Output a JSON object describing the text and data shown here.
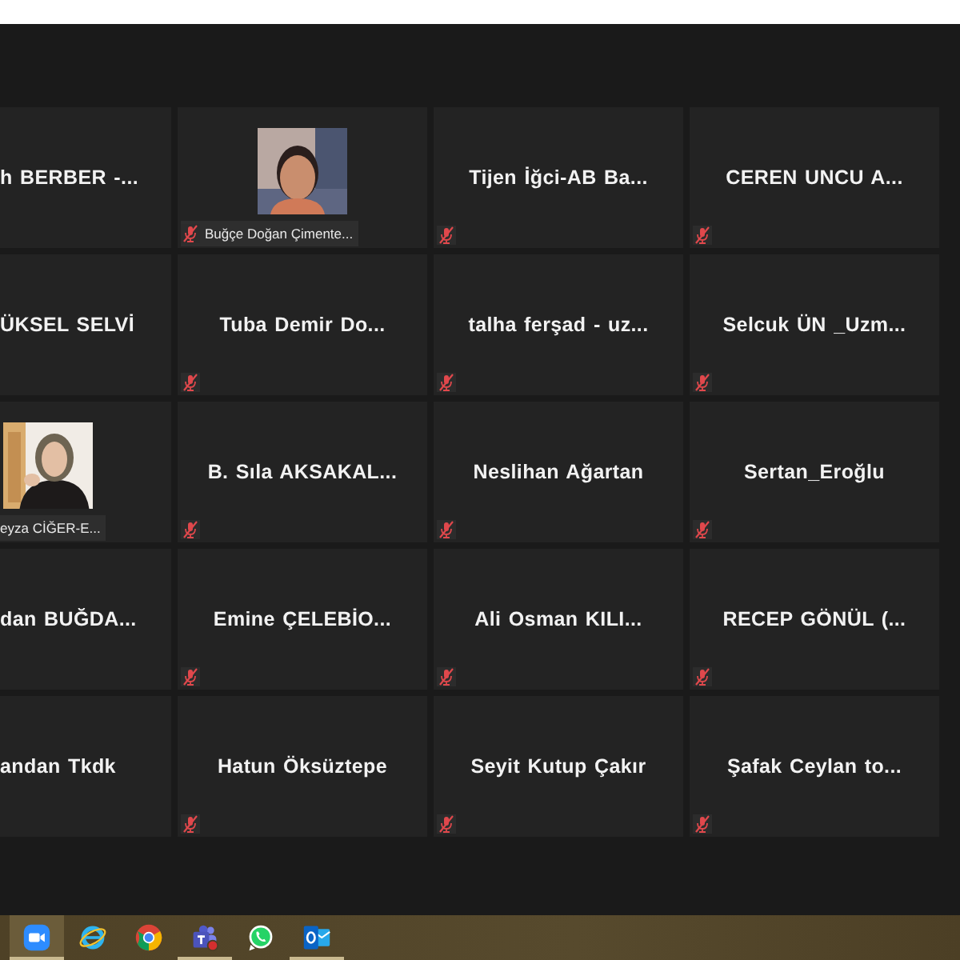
{
  "tiles": [
    {
      "kind": "name",
      "name": "h BERBER -..."
    },
    {
      "kind": "video",
      "name": "Buğçe Doğan Çimente...",
      "muted": true
    },
    {
      "kind": "name",
      "name": "Tijen İğci-AB Ba...",
      "muted": true
    },
    {
      "kind": "name",
      "name": "CEREN UNCU A...",
      "muted": true
    },
    {
      "kind": "name",
      "name": "ÜKSEL SELVİ"
    },
    {
      "kind": "name",
      "name": "Tuba Demir Do...",
      "muted": true
    },
    {
      "kind": "name",
      "name": "talha ferşad - uz...",
      "muted": true
    },
    {
      "kind": "name",
      "name": "Selcuk ÜN _Uzm...",
      "muted": true
    },
    {
      "kind": "video",
      "name": "eyza CİĞER-E..."
    },
    {
      "kind": "name",
      "name": "B. Sıla AKSAKAL...",
      "muted": true
    },
    {
      "kind": "name",
      "name": "Neslihan Ağartan",
      "muted": true
    },
    {
      "kind": "name",
      "name": "Sertan_Eroğlu",
      "muted": true
    },
    {
      "kind": "name",
      "name": "dan BUĞDA..."
    },
    {
      "kind": "name",
      "name": "Emine ÇELEBİO...",
      "muted": true
    },
    {
      "kind": "name",
      "name": "Ali Osman KILI...",
      "muted": true
    },
    {
      "kind": "name",
      "name": "RECEP GÖNÜL (...",
      "muted": true
    },
    {
      "kind": "name",
      "name": "andan Tkdk"
    },
    {
      "kind": "name",
      "name": "Hatun Öksüztepe",
      "muted": true
    },
    {
      "kind": "name",
      "name": "Seyit Kutup Çakır",
      "muted": true
    },
    {
      "kind": "name",
      "name": "Şafak Ceylan to...",
      "muted": true
    }
  ],
  "taskbar": [
    {
      "kind": "zoom",
      "running": true
    },
    {
      "kind": "ie",
      "running": false
    },
    {
      "kind": "chrome",
      "running": false
    },
    {
      "kind": "teams",
      "running": true
    },
    {
      "kind": "whatsapp",
      "running": false
    },
    {
      "kind": "outlook",
      "running": true
    }
  ]
}
